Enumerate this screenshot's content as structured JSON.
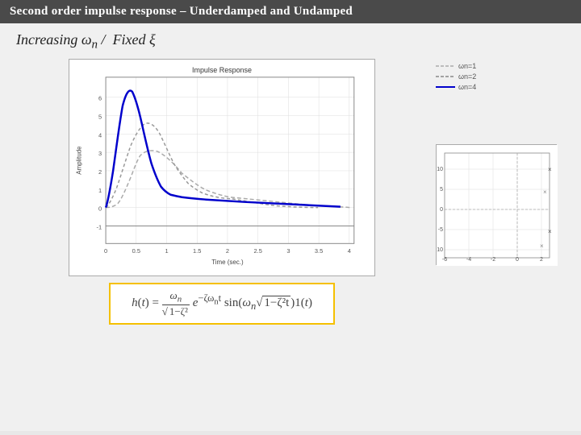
{
  "header": {
    "title": "Second order impulse response – Underdamped and Undamped"
  },
  "subtitle": {
    "text": "Increasing",
    "math1": "ωn /",
    "fixed": "Fixed",
    "math2": "ξ"
  },
  "plot": {
    "title": "Impulse Response",
    "x_label": "Time (sec.)",
    "y_label": "Amplitude",
    "x_ticks": [
      "0",
      "0.5",
      "1",
      "1.5",
      "2",
      "2.5",
      "3",
      "3.5",
      "4"
    ],
    "y_ticks": [
      "-1",
      "0",
      "1",
      "2",
      "3",
      "4",
      "5",
      "6"
    ]
  },
  "formula": {
    "display": "h(t) = (ωn / √(1−ζ²)) · e^(−ζωn t) · sin(ωn√(1−ζ²t)) · 1(t)"
  },
  "right_plot": {
    "x_ticks": [
      "-6",
      "-4",
      "-2",
      "0",
      "2"
    ],
    "y_ticks": [
      "-10",
      "-5",
      "0",
      "5",
      "10"
    ]
  },
  "legend": {
    "items": [
      {
        "label": "ωn=1",
        "color": "#aaaaaa",
        "style": "dashed"
      },
      {
        "label": "ωn=2",
        "color": "#888888",
        "style": "dashed"
      },
      {
        "label": "ωn=4",
        "color": "#0000cc",
        "style": "solid"
      }
    ]
  }
}
